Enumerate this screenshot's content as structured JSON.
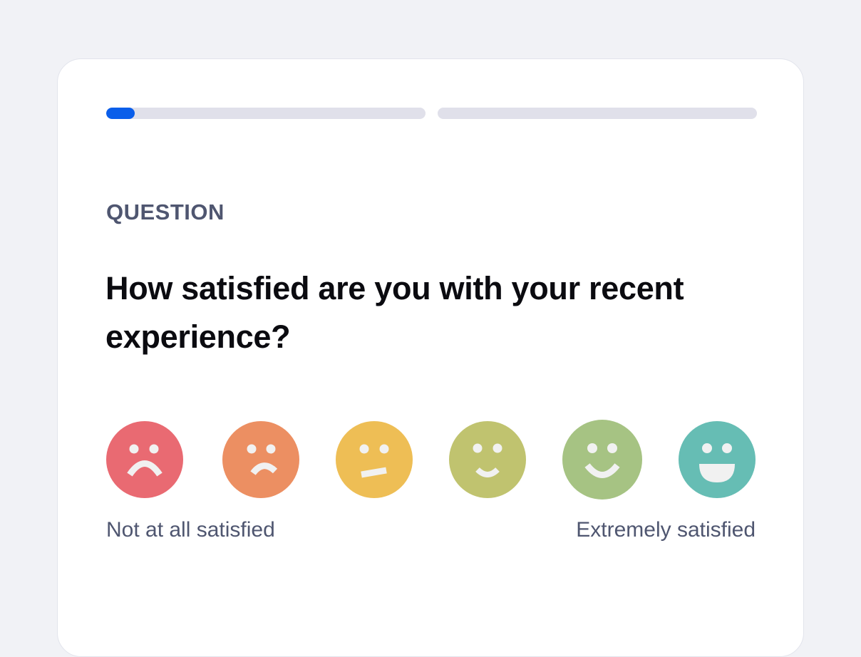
{
  "colors": {
    "page_background": "#f1f2f6",
    "progress_fill": "#0a5eea",
    "progress_track": "#e0e0ea",
    "face_feature": "#f1f1f1"
  },
  "progress": {
    "segments": [
      {
        "fill_fraction": 0.09
      },
      {
        "fill_fraction": 0
      }
    ]
  },
  "question": {
    "eyebrow": "QUESTION",
    "text": "How satisfied are you with your recent experience?"
  },
  "rating": {
    "options": [
      {
        "icon": "very-sad-face-icon",
        "color": "#e96a72"
      },
      {
        "icon": "sad-face-icon",
        "color": "#ec8f62"
      },
      {
        "icon": "neutral-face-icon",
        "color": "#eebe55"
      },
      {
        "icon": "slight-smile-face-icon",
        "color": "#c0c36f"
      },
      {
        "icon": "smile-face-icon",
        "color": "#a6c383"
      },
      {
        "icon": "big-smile-face-icon",
        "color": "#66bdb4"
      }
    ],
    "low_label": "Not at all satisfied",
    "high_label": "Extremely satisfied"
  }
}
